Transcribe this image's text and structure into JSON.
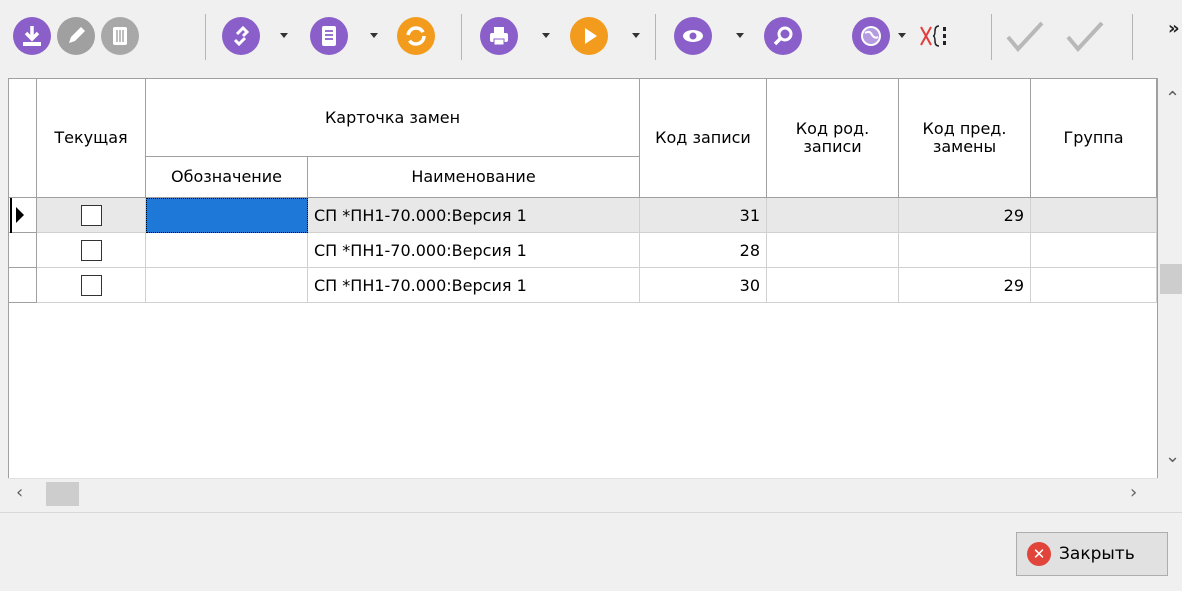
{
  "toolbar": {
    "buttons": [
      {
        "icon": "download-icon",
        "color": "#8a5fc9"
      },
      {
        "icon": "edit-icon",
        "color": "#a0a0a0"
      },
      {
        "icon": "delete-icon",
        "color": "#a8a8a8"
      },
      {
        "icon": "link-icon",
        "color": "#8a5fc9"
      },
      {
        "icon": "document-icon",
        "color": "#8a5fc9"
      },
      {
        "icon": "refresh-icon",
        "color": "#f39b1c"
      },
      {
        "icon": "print-icon",
        "color": "#8a5fc9"
      },
      {
        "icon": "play-icon",
        "color": "#f39b1c"
      },
      {
        "icon": "view-icon",
        "color": "#8a5fc9"
      },
      {
        "icon": "search-icon",
        "color": "#8a5fc9"
      },
      {
        "icon": "globe-icon",
        "color": "#8a5fc9"
      },
      {
        "icon": "formula-icon",
        "color": "#e23b3b"
      },
      {
        "icon": "check-icon",
        "color": "#b0b0b0"
      },
      {
        "icon": "check-all-icon",
        "color": "#b0b0b0"
      }
    ],
    "more_label": "»"
  },
  "grid": {
    "headers": {
      "current": "Текущая",
      "card_group": "Карточка замен",
      "designation": "Обозначение",
      "name": "Наименование",
      "record_code": "Код записи",
      "parent_code": "Код род. записи",
      "prev_code": "Код пред. замены",
      "group": "Группа"
    },
    "rows": [
      {
        "current": false,
        "designation": "",
        "name": "СП *ПН1-70.000:Версия 1",
        "record_code": "31",
        "parent_code": "",
        "prev_code": "29",
        "group": "",
        "selected": true
      },
      {
        "current": false,
        "designation": "",
        "name": "СП *ПН1-70.000:Версия 1",
        "record_code": "28",
        "parent_code": "",
        "prev_code": "",
        "group": "",
        "selected": false
      },
      {
        "current": false,
        "designation": "",
        "name": "СП *ПН1-70.000:Версия 1",
        "record_code": "30",
        "parent_code": "",
        "prev_code": "29",
        "group": "",
        "selected": false
      }
    ]
  },
  "footer": {
    "close_label": "Закрыть",
    "close_icon_glyph": "✕"
  },
  "colors": {
    "accent_purple": "#8a5fc9",
    "accent_orange": "#f39b1c",
    "selection_blue": "#1e78d7",
    "close_red": "#e0443a"
  }
}
